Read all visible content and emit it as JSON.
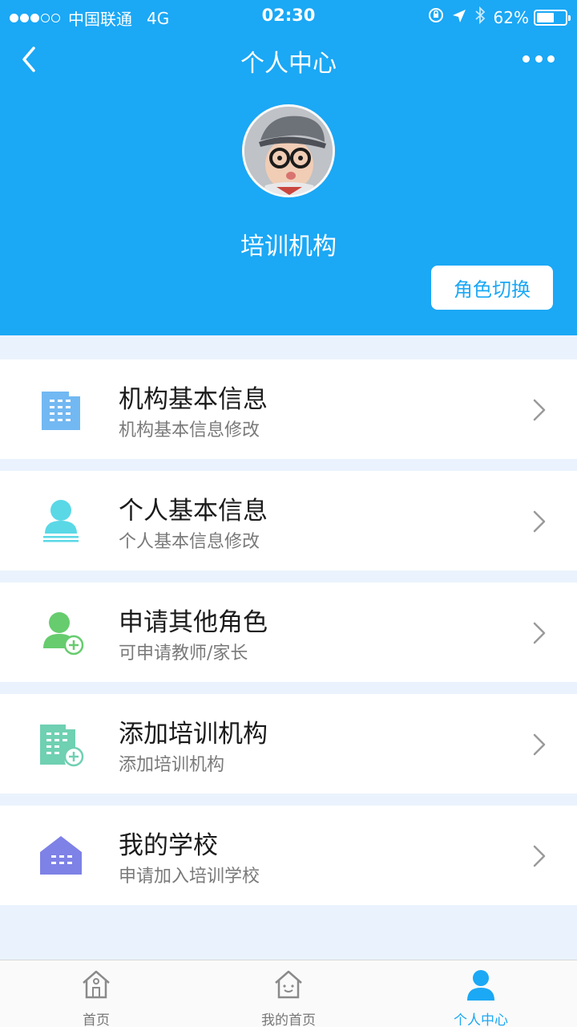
{
  "status_bar": {
    "carrier": "中国联通",
    "network": "4G",
    "time": "02:30",
    "battery": "62%",
    "battery_level": 0.62
  },
  "nav": {
    "title": "个人中心",
    "back_icon": "chevron-left-icon",
    "more_icon": "more-dots-icon"
  },
  "profile": {
    "name": "培训机构",
    "role_switch_label": "角色切换"
  },
  "menu": {
    "items": [
      {
        "title": "机构基本信息",
        "subtitle": "机构基本信息修改",
        "icon": "building-icon",
        "color": "#72b8f2"
      },
      {
        "title": "个人基本信息",
        "subtitle": "个人基本信息修改",
        "icon": "person-icon",
        "color": "#5ad8e6"
      },
      {
        "title": "申请其他角色",
        "subtitle": "可申请教师/家长",
        "icon": "add-person-icon",
        "color": "#66cc6e"
      },
      {
        "title": "添加培训机构",
        "subtitle": "添加培训机构",
        "icon": "add-building-icon",
        "color": "#6fd0b2"
      },
      {
        "title": "我的学校",
        "subtitle": "申请加入培训学校",
        "icon": "school-icon",
        "color": "#7e81e6"
      }
    ]
  },
  "tabbar": {
    "tabs": [
      {
        "label": "首页",
        "icon": "home-icon"
      },
      {
        "label": "我的首页",
        "icon": "my-home-icon"
      },
      {
        "label": "个人中心",
        "icon": "user-icon"
      }
    ],
    "active_index": 2,
    "active_color": "#1ba8f5"
  },
  "colors": {
    "header_bg": "#1ba8f5",
    "page_bg": "#eaf3fd"
  }
}
